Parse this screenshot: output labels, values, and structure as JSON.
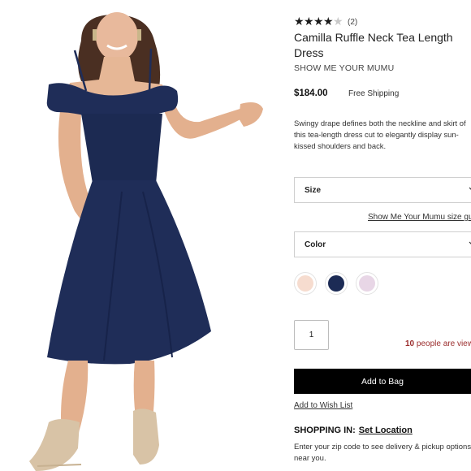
{
  "product": {
    "rating_value": 4,
    "rating_max": 5,
    "review_count": "(2)",
    "title": "Camilla Ruffle Neck Tea Length Dress",
    "brand": "SHOW ME YOUR MUMU",
    "price": "$184.00",
    "shipping": "Free Shipping",
    "description": "Swingy drape defines both the neckline and skirt of this tea-length dress cut to elegantly display sun-kissed shoulders and back."
  },
  "size_select": {
    "label": "Size"
  },
  "size_guide_link": "Show Me Your Mumu size guide",
  "color_select": {
    "label": "Color"
  },
  "swatches": [
    {
      "name": "blush-swatch",
      "color": "#f6dccf"
    },
    {
      "name": "navy-swatch",
      "color": "#1c2b55"
    },
    {
      "name": "lilac-swatch",
      "color": "#e8d6e6"
    }
  ],
  "quantity": "1",
  "viewing": {
    "count": "10",
    "text": " people are viewing"
  },
  "add_to_bag": "Add to Bag",
  "wishlist": "Add to Wish List",
  "shopping_in": {
    "label": "SHOPPING IN:",
    "link": "Set Location"
  },
  "zip_note": "Enter your zip code to see delivery & pickup options near you.",
  "colors": {
    "dress": "#1f2d58",
    "button": "#000000",
    "viewing_text": "#9b2d2d"
  }
}
